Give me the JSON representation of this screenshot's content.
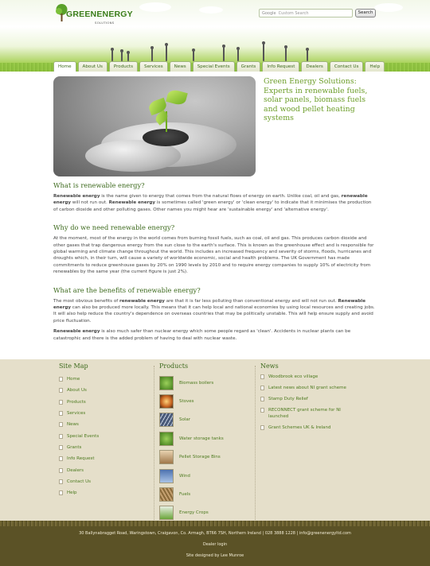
{
  "header": {
    "logo_text": "GREENENERGY",
    "logo_sub": "SOLUTIONS",
    "search_brand": "Google",
    "search_placeholder": "Custom Search",
    "search_button": "Search"
  },
  "nav": {
    "tabs": [
      {
        "label": "Home",
        "active": true
      },
      {
        "label": "About Us"
      },
      {
        "label": "Products"
      },
      {
        "label": "Services"
      },
      {
        "label": "News"
      },
      {
        "label": "Special Events"
      },
      {
        "label": "Grants"
      },
      {
        "label": "Info Request"
      },
      {
        "label": "Dealers"
      },
      {
        "label": "Contact Us"
      },
      {
        "label": "Help"
      }
    ]
  },
  "hero": {
    "tagline": "Green Energy Solutions: Experts in renewable fuels, solar panels, biomass fuels and wood pellet heating systems"
  },
  "article": {
    "s1_title": "What is renewable energy?",
    "s1_p1": "Renewable energy is the name given to energy that comes from the natural flows of energy on earth. Unlike coal, oil and gas, renewable energy will not run out. Renewable energy is sometimes called 'green energy' or 'clean energy' to indicate that it minimises the production of carbon dioxide and other polluting gases. Other names you might hear are 'sustainable energy' and 'alternative energy'.",
    "s2_title": "Why do we need renewable energy?",
    "s2_p1": "At the moment, most of the energy in the world comes from burning fossil fuels, such as coal, oil and gas. This produces carbon dioxide and other gases that trap dangerous energy from the sun close to the earth's surface. This is known as the greenhouse effect and is responsible for global warming and climate change throughout the world. This includes an increased frequency and severity of storms, floods, hurricanes and droughts which, in their turn, will cause a variety of worldwide economic, social and health problems. The UK Government has made commitments to reduce greenhouse gases by 20% on 1990 levels by 2010 and to require energy companies to supply 10% of electricity from renewables by the same year (the current figure is just 2%).",
    "s3_title": "What are the benefits of renewable energy?",
    "s3_p1": "The most obvious benefits of renewable energy are that it is far less polluting than conventional energy and will not run out. Renewable energy can also be produced more locally. This means that it can help local and national economies by using local resources and creating jobs. It will also help reduce the country's dependence on overseas countries that may be politically unstable. This will help ensure supply and avoid price fluctuation.",
    "s3_p2": "Renewable energy is also much safer than nuclear energy which some people regard as 'clean'. Accidents in nuclear plants can be catastrophic and there is the added problem of having to deal with nuclear waste."
  },
  "sitemap": {
    "title": "Site Map",
    "items": [
      "Home",
      "About Us",
      "Products",
      "Services",
      "News",
      "Special Events",
      "Grants",
      "Info Request",
      "Dealers",
      "Contact Us",
      "Help"
    ]
  },
  "products": {
    "title": "Products",
    "items": [
      {
        "label": "Biomass boilers",
        "color": "#4f8a2a"
      },
      {
        "label": "Stoves",
        "color": "#d98c2b"
      },
      {
        "label": "Solar",
        "color": "#6a7890"
      },
      {
        "label": "Water storage tanks",
        "color": "#4f8a2a"
      },
      {
        "label": "Pellet Storage Bins",
        "color": "#b58a5a"
      },
      {
        "label": "Wind",
        "color": "#5b7aa8"
      },
      {
        "label": "Fuels",
        "color": "#9a7a4a"
      },
      {
        "label": "Energy Crops",
        "color": "#6aa63a"
      }
    ]
  },
  "news": {
    "title": "News",
    "items": [
      "Woodbrook eco village",
      "Latest news about NI grant scheme",
      "Stamp Duty Relief",
      "RECONNECT grant scheme for NI launched",
      "Grant Schemes UK & Ireland"
    ]
  },
  "footer": {
    "address": "30 Ballynabragget Road, Waringstown, Craigavon, Co. Armagh, BT66 7SH, Northern Ireland | 028 3888 1228 | info@greenenergyltd.com",
    "dealer_login": "Dealer login",
    "credit": "Site designed by Lee Munroe"
  },
  "colors": {
    "brand_green": "#3d6a1d",
    "accent_green": "#6d9e2a",
    "footer_bg": "#5b5226",
    "panel_bg": "#e5dfca"
  }
}
